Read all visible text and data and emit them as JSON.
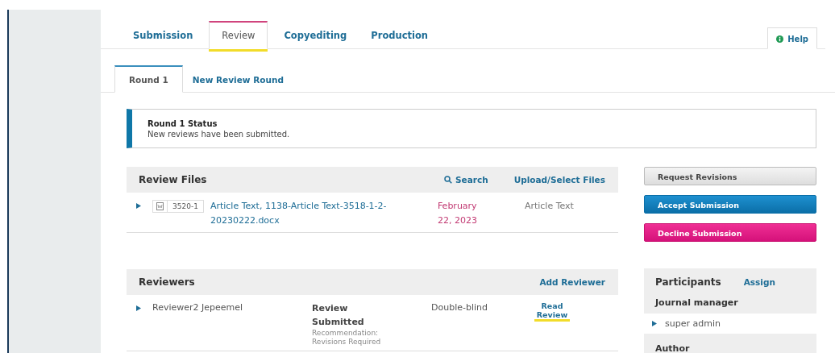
{
  "tabs": [
    {
      "label": "Submission",
      "selected": false,
      "highlighted": false
    },
    {
      "label": "Review",
      "selected": true,
      "highlighted": true
    },
    {
      "label": "Copyediting",
      "selected": false,
      "highlighted": false
    },
    {
      "label": "Production",
      "selected": false,
      "highlighted": false
    }
  ],
  "help": "Help",
  "rounds": [
    {
      "label": "Round 1",
      "selected": true
    },
    {
      "label": "New Review Round",
      "selected": false
    }
  ],
  "status": {
    "title": "Round 1 Status",
    "message": "New reviews have been submitted."
  },
  "review_files": {
    "title": "Review Files",
    "actions": [
      {
        "label": "Search",
        "kind": "search"
      },
      {
        "label": "Upload/Select Files",
        "kind": "link"
      }
    ],
    "rows": [
      {
        "expanded": false,
        "file_id": "3520-1",
        "name": "Article Text, 1138-Article Text-3518-1-2-20230222.docx",
        "date": "February 22, 2023",
        "type": "Article Text"
      }
    ]
  },
  "reviewers": {
    "title": "Reviewers",
    "action": "Add Reviewer",
    "rows": [
      {
        "expanded": false,
        "name": "Reviewer2 Jepeemel",
        "status": "Review Submitted",
        "recommendation": "Recommendation: Revisions Required",
        "method": "Double-blind",
        "action": "Read Review",
        "highlighted": true
      }
    ]
  },
  "decisions": [
    {
      "label": "Request Revisions",
      "kind": "default"
    },
    {
      "label": "Accept Submission",
      "kind": "primary"
    },
    {
      "label": "Decline Submission",
      "kind": "danger"
    }
  ],
  "participants": {
    "title": "Participants",
    "action": "Assign",
    "groups": [
      {
        "role": "Journal manager",
        "members": [
          {
            "name": "super admin",
            "expanded": false
          }
        ]
      },
      {
        "role": "Author"
      }
    ]
  }
}
